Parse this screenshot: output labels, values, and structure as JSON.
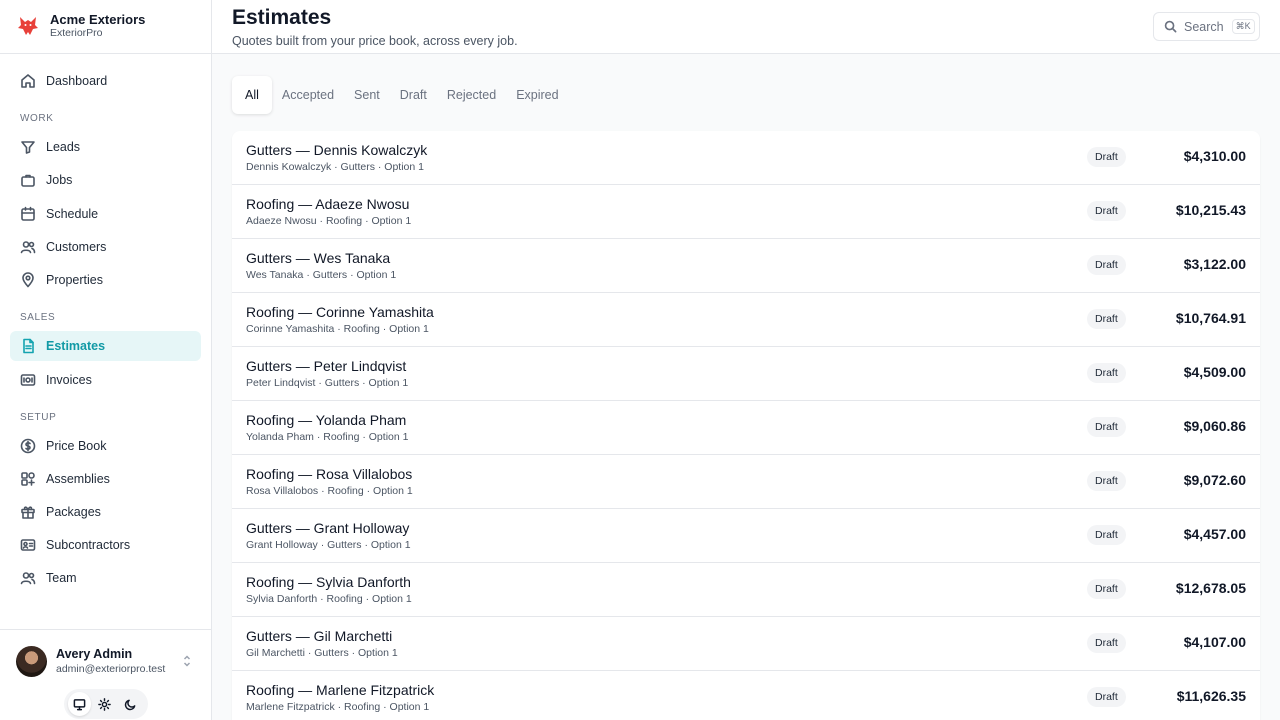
{
  "brand": {
    "name": "Acme Exteriors",
    "product": "ExteriorPro",
    "logo_color": "#e8413a"
  },
  "nav": {
    "dashboard": "Dashboard",
    "sections": {
      "work": "WORK",
      "sales": "SALES",
      "setup": "SETUP"
    },
    "work": [
      "Leads",
      "Jobs",
      "Schedule",
      "Customers",
      "Properties"
    ],
    "sales": [
      "Estimates",
      "Invoices"
    ],
    "setup": [
      "Price Book",
      "Assemblies",
      "Packages",
      "Subcontractors",
      "Team"
    ],
    "active": "Estimates",
    "accent": "#14a3b0"
  },
  "user": {
    "name": "Avery Admin",
    "email": "admin@exteriorpro.test"
  },
  "header": {
    "title": "Estimates",
    "subtitle": "Quotes built from your price book, across every job.",
    "search_placeholder": "Search",
    "search_shortcut": "⌘K"
  },
  "tabs": [
    "All",
    "Accepted",
    "Sent",
    "Draft",
    "Rejected",
    "Expired"
  ],
  "active_tab": "All",
  "estimates": [
    {
      "title": "Gutters — Dennis Kowalczyk",
      "meta": "Dennis Kowalczyk · Gutters · Option 1",
      "status": "Draft",
      "amount": "$4,310.00"
    },
    {
      "title": "Roofing — Adaeze Nwosu",
      "meta": "Adaeze Nwosu · Roofing · Option 1",
      "status": "Draft",
      "amount": "$10,215.43"
    },
    {
      "title": "Gutters — Wes Tanaka",
      "meta": "Wes Tanaka · Gutters · Option 1",
      "status": "Draft",
      "amount": "$3,122.00"
    },
    {
      "title": "Roofing — Corinne Yamashita",
      "meta": "Corinne Yamashita · Roofing · Option 1",
      "status": "Draft",
      "amount": "$10,764.91"
    },
    {
      "title": "Gutters — Peter Lindqvist",
      "meta": "Peter Lindqvist · Gutters · Option 1",
      "status": "Draft",
      "amount": "$4,509.00"
    },
    {
      "title": "Roofing — Yolanda Pham",
      "meta": "Yolanda Pham · Roofing · Option 1",
      "status": "Draft",
      "amount": "$9,060.86"
    },
    {
      "title": "Roofing — Rosa Villalobos",
      "meta": "Rosa Villalobos · Roofing · Option 1",
      "status": "Draft",
      "amount": "$9,072.60"
    },
    {
      "title": "Gutters — Grant Holloway",
      "meta": "Grant Holloway · Gutters · Option 1",
      "status": "Draft",
      "amount": "$4,457.00"
    },
    {
      "title": "Roofing — Sylvia Danforth",
      "meta": "Sylvia Danforth · Roofing · Option 1",
      "status": "Draft",
      "amount": "$12,678.05"
    },
    {
      "title": "Gutters — Gil Marchetti",
      "meta": "Gil Marchetti · Gutters · Option 1",
      "status": "Draft",
      "amount": "$4,107.00"
    },
    {
      "title": "Roofing — Marlene Fitzpatrick",
      "meta": "Marlene Fitzpatrick · Roofing · Option 1",
      "status": "Draft",
      "amount": "$11,626.35"
    }
  ]
}
